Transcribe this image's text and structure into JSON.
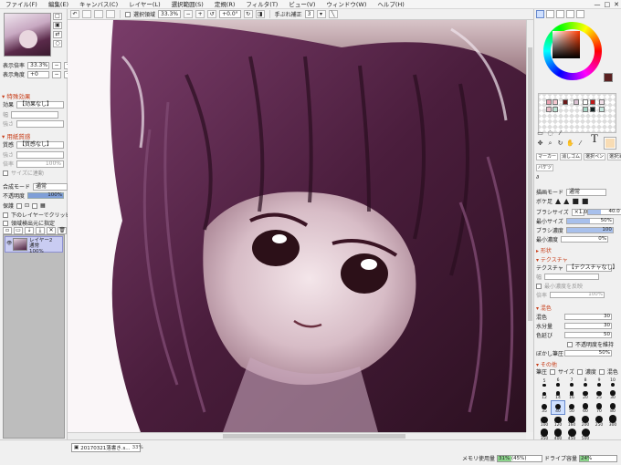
{
  "menu": [
    "ファイル(F)",
    "編集(E)",
    "キャンバス(C)",
    "レイヤー(L)",
    "選択範囲(S)",
    "定規(R)",
    "フィルタ(T)",
    "ビュー(V)",
    "ウィンドウ(W)",
    "ヘルプ(H)"
  ],
  "window_controls": [
    "—",
    "□",
    "✕"
  ],
  "toolbar": {
    "selection_label": "選択領域",
    "zoom": "33.3%",
    "rotation": "+0.0°",
    "stabilizer_label": "手ぶれ補正",
    "stabilizer_value": "3"
  },
  "left": {
    "zoom_label": "表示倍率",
    "zoom_value": "33.3%",
    "angle_label": "表示角度",
    "angle_value": "+0",
    "effect_title": "特殊効果",
    "effect_label": "効果",
    "effect_value": "【効果なし】",
    "effect_sub1": "幅",
    "effect_sub2": "強さ",
    "paper_title": "用紙質感",
    "paper_label": "質感",
    "paper_value": "【質感なし】",
    "paper_sub1": "強さ",
    "paper_sub2": "倍率",
    "paper_sub3": "100%",
    "paper_sub4": "サイズに連動",
    "blend_label": "合成モード",
    "blend_value": "通常",
    "opacity_label": "不透明度",
    "opacity_value": "100%",
    "opacity_fraction": 1.0,
    "protect_label": "保護",
    "clip_label": "下のレイヤーでクリッピング",
    "select_source_label": "領域検出元に指定",
    "layer_name": "レイヤー2",
    "layer_mode": "通常",
    "layer_opacity": "100%"
  },
  "right": {
    "tool_tabs": [
      "マーカー",
      "消しゴム",
      "選択ペン",
      "選択消し"
    ],
    "tool_tab_extra": "バケツ",
    "draw_mode_label": "描画モード",
    "draw_mode_value": "通常",
    "edge_label": "ボケ足",
    "brush_size_label": "ブラシサイズ",
    "brush_size_mult": "×1.0",
    "brush_size_value": "40.0",
    "min_size_label": "最小サイズ",
    "min_size_value": "50%",
    "min_size_fraction": 0.5,
    "density_label": "ブラシ濃度",
    "density_value": "100",
    "density_fraction": 1.0,
    "min_density_label": "最小濃度",
    "min_density_value": "0%",
    "shape_title": "形状",
    "texture_title": "テクスチャ",
    "texture_label": "テクスチャ",
    "texture_value": "【テクスチャなし】",
    "texture_width_label": "幅",
    "texture_invert_label": "最小濃度を反映",
    "texture_scale_label": "倍率",
    "texture_scale_value": "100%",
    "mix_title": "混色",
    "mix_label": "混色",
    "mix_value": "30",
    "moisture_label": "水分量",
    "moisture_value": "30",
    "persist_label": "色延び",
    "persist_value": "50",
    "keep_opacity_label": "不透明度を維持",
    "blur_label": "ぼかし筆圧",
    "blur_value": "50%",
    "other_title": "その他",
    "pressure_label": "筆圧",
    "pressure_size": "サイズ",
    "pressure_density": "濃度",
    "pressure_mix": "混色",
    "brush_sizes": [
      "5",
      "6",
      "7",
      "8",
      "9",
      "10",
      "12",
      "14",
      "16",
      "20",
      "25",
      "30",
      "35",
      "40",
      "50",
      "60",
      "70",
      "80",
      "100",
      "120",
      "160",
      "200",
      "250",
      "300",
      "350",
      "400",
      "450",
      "500"
    ]
  },
  "status": {
    "document_name": "20170321落書き.s...",
    "document_zoom": "33%",
    "memory_label": "メモリ使用量",
    "memory_value": "31% (45%)",
    "memory_fraction": 0.31,
    "drive_label": "ドライブ容量",
    "drive_value": "24%",
    "drive_fraction": 0.24
  }
}
